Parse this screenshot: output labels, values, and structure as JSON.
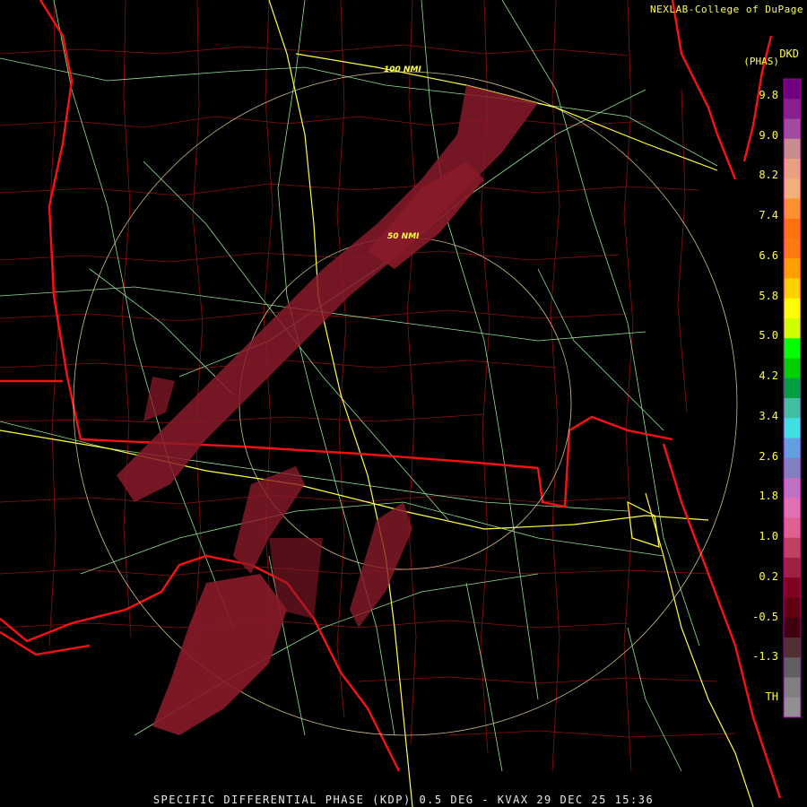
{
  "header": {
    "credit": "NEXLAB-College of DuPage",
    "product_code": "DKD",
    "unit": "(PHAS)"
  },
  "range_rings": [
    {
      "label": "50 NMI"
    },
    {
      "label": "100 NMI"
    }
  ],
  "color_scale": {
    "labels": [
      "9.8",
      "9.0",
      "8.2",
      "7.4",
      "6.6",
      "5.8",
      "5.0",
      "4.2",
      "3.4",
      "2.6",
      "1.8",
      "1.0",
      "0.2",
      "-0.5",
      "-1.3",
      "TH"
    ],
    "colors": [
      "#70007f",
      "#8a1f8f",
      "#a04aa0",
      "#c88c8c",
      "#e8a080",
      "#f0b078",
      "#ff9030",
      "#ff7010",
      "#ff7a10",
      "#ffa000",
      "#ffd000",
      "#ffff00",
      "#d0ff00",
      "#00ff00",
      "#00d000",
      "#00a040",
      "#40c0a0",
      "#40e0e0",
      "#60a0e0",
      "#8080c0",
      "#c070c0",
      "#e070b0",
      "#e06090",
      "#c04060",
      "#a02040",
      "#800020",
      "#600010",
      "#400010",
      "#503030",
      "#606060",
      "#808080",
      "#909090"
    ],
    "caption_note": "scale"
  },
  "footer": {
    "caption": "SPECIFIC DIFFERENTIAL PHASE (KDP) 0.5 DEG - KVAX 29 DEC 25 15:36"
  },
  "colors": {
    "state_border": "#ff1010",
    "county_border": "#b01010",
    "highway": "#ffff40",
    "road": "#90e090",
    "range_ring": "#f0e0a0",
    "echo": "#8a1a2a"
  }
}
